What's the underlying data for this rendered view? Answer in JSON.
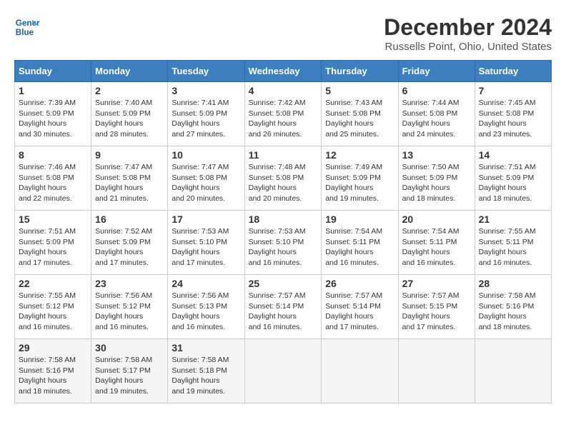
{
  "logo": {
    "line1": "General",
    "line2": "Blue"
  },
  "title": "December 2024",
  "location": "Russells Point, Ohio, United States",
  "headers": [
    "Sunday",
    "Monday",
    "Tuesday",
    "Wednesday",
    "Thursday",
    "Friday",
    "Saturday"
  ],
  "weeks": [
    [
      {
        "day": "1",
        "rise": "7:39 AM",
        "set": "5:09 PM",
        "daylight": "9 hours and 30 minutes."
      },
      {
        "day": "2",
        "rise": "7:40 AM",
        "set": "5:09 PM",
        "daylight": "9 hours and 28 minutes."
      },
      {
        "day": "3",
        "rise": "7:41 AM",
        "set": "5:09 PM",
        "daylight": "9 hours and 27 minutes."
      },
      {
        "day": "4",
        "rise": "7:42 AM",
        "set": "5:08 PM",
        "daylight": "9 hours and 26 minutes."
      },
      {
        "day": "5",
        "rise": "7:43 AM",
        "set": "5:08 PM",
        "daylight": "9 hours and 25 minutes."
      },
      {
        "day": "6",
        "rise": "7:44 AM",
        "set": "5:08 PM",
        "daylight": "9 hours and 24 minutes."
      },
      {
        "day": "7",
        "rise": "7:45 AM",
        "set": "5:08 PM",
        "daylight": "9 hours and 23 minutes."
      }
    ],
    [
      {
        "day": "8",
        "rise": "7:46 AM",
        "set": "5:08 PM",
        "daylight": "9 hours and 22 minutes."
      },
      {
        "day": "9",
        "rise": "7:47 AM",
        "set": "5:08 PM",
        "daylight": "9 hours and 21 minutes."
      },
      {
        "day": "10",
        "rise": "7:47 AM",
        "set": "5:08 PM",
        "daylight": "9 hours and 20 minutes."
      },
      {
        "day": "11",
        "rise": "7:48 AM",
        "set": "5:08 PM",
        "daylight": "9 hours and 20 minutes."
      },
      {
        "day": "12",
        "rise": "7:49 AM",
        "set": "5:09 PM",
        "daylight": "9 hours and 19 minutes."
      },
      {
        "day": "13",
        "rise": "7:50 AM",
        "set": "5:09 PM",
        "daylight": "9 hours and 18 minutes."
      },
      {
        "day": "14",
        "rise": "7:51 AM",
        "set": "5:09 PM",
        "daylight": "9 hours and 18 minutes."
      }
    ],
    [
      {
        "day": "15",
        "rise": "7:51 AM",
        "set": "5:09 PM",
        "daylight": "9 hours and 17 minutes."
      },
      {
        "day": "16",
        "rise": "7:52 AM",
        "set": "5:09 PM",
        "daylight": "9 hours and 17 minutes."
      },
      {
        "day": "17",
        "rise": "7:53 AM",
        "set": "5:10 PM",
        "daylight": "9 hours and 17 minutes."
      },
      {
        "day": "18",
        "rise": "7:53 AM",
        "set": "5:10 PM",
        "daylight": "9 hours and 16 minutes."
      },
      {
        "day": "19",
        "rise": "7:54 AM",
        "set": "5:11 PM",
        "daylight": "9 hours and 16 minutes."
      },
      {
        "day": "20",
        "rise": "7:54 AM",
        "set": "5:11 PM",
        "daylight": "9 hours and 16 minutes."
      },
      {
        "day": "21",
        "rise": "7:55 AM",
        "set": "5:11 PM",
        "daylight": "9 hours and 16 minutes."
      }
    ],
    [
      {
        "day": "22",
        "rise": "7:55 AM",
        "set": "5:12 PM",
        "daylight": "9 hours and 16 minutes."
      },
      {
        "day": "23",
        "rise": "7:56 AM",
        "set": "5:12 PM",
        "daylight": "9 hours and 16 minutes."
      },
      {
        "day": "24",
        "rise": "7:56 AM",
        "set": "5:13 PM",
        "daylight": "9 hours and 16 minutes."
      },
      {
        "day": "25",
        "rise": "7:57 AM",
        "set": "5:14 PM",
        "daylight": "9 hours and 16 minutes."
      },
      {
        "day": "26",
        "rise": "7:57 AM",
        "set": "5:14 PM",
        "daylight": "9 hours and 17 minutes."
      },
      {
        "day": "27",
        "rise": "7:57 AM",
        "set": "5:15 PM",
        "daylight": "9 hours and 17 minutes."
      },
      {
        "day": "28",
        "rise": "7:58 AM",
        "set": "5:16 PM",
        "daylight": "9 hours and 18 minutes."
      }
    ],
    [
      {
        "day": "29",
        "rise": "7:58 AM",
        "set": "5:16 PM",
        "daylight": "9 hours and 18 minutes."
      },
      {
        "day": "30",
        "rise": "7:58 AM",
        "set": "5:17 PM",
        "daylight": "9 hours and 19 minutes."
      },
      {
        "day": "31",
        "rise": "7:58 AM",
        "set": "5:18 PM",
        "daylight": "9 hours and 19 minutes."
      },
      null,
      null,
      null,
      null
    ]
  ]
}
